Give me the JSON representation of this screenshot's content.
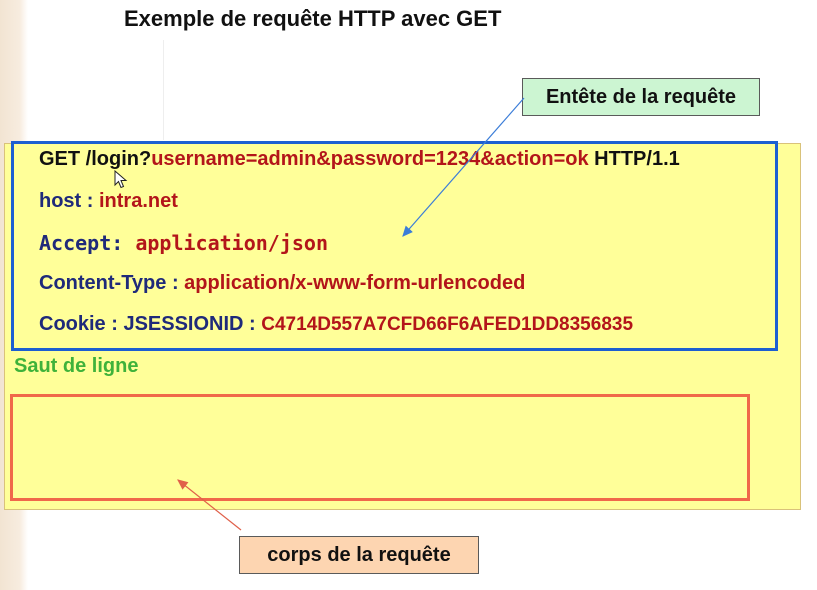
{
  "title": "Exemple de requête HTTP avec GET",
  "request_header": {
    "line1": {
      "method_path": "GET /login?",
      "query": "username=admin&password=1234&action=ok",
      "version": " HTTP/1.1"
    },
    "line2": {
      "key": "host : ",
      "value": "intra.net"
    },
    "line3": {
      "key": "Accept: ",
      "value": "application/json"
    },
    "line4": {
      "key": "Content-Type : ",
      "value": "application/x-www-form-urlencoded"
    },
    "line5": {
      "key": "Cookie : JSESSIONID : ",
      "value": "C4714D557A7CFD66F6AFED1DD8356835"
    }
  },
  "callouts": {
    "header": "Entête de la requête",
    "blank_line": "Saut de ligne",
    "body": "corps de la requête"
  },
  "colors": {
    "header_border": "#1d5fd1",
    "body_border": "#f0684a",
    "panel_background": "#ffff99",
    "value_red": "#b3151a",
    "key_navy": "#1f2a7a"
  }
}
